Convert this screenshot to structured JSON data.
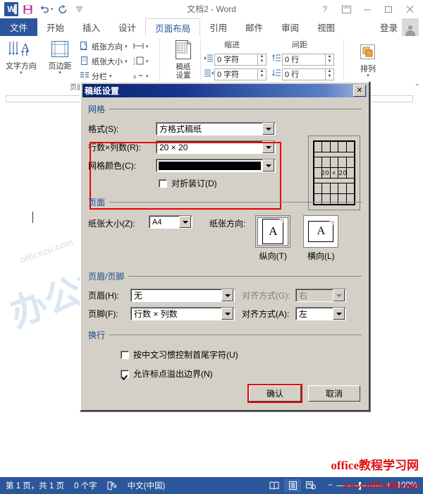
{
  "titlebar": {
    "doc_title": "文档2 - Word",
    "logo": "W",
    "save_icon": "save-icon",
    "undo_icon": "undo-icon",
    "redo_icon": "redo-icon",
    "customize_icon": "customize-qat-icon",
    "help": "?",
    "ribbon_display": "ribbon-display-options-icon",
    "minimize": "−",
    "maximize": "▢",
    "close": "✕"
  },
  "tabs": {
    "file": "文件",
    "items": [
      "开始",
      "插入",
      "设计",
      "页面布局",
      "引用",
      "邮件",
      "审阅",
      "视图"
    ],
    "active": "页面布局",
    "signin": "登录"
  },
  "ribbon": {
    "group_page_setup": "页面设置",
    "text_direction": "文字方向",
    "margins": "页边距",
    "paper_orientation": "纸张方向",
    "paper_size": "纸张大小",
    "columns": "分栏",
    "breaks_icon": "breaks-icon",
    "line_numbers_icon": "line-numbers-icon",
    "hyphenation_icon": "hyphenation-icon",
    "manuscript_setup": "稿纸\n设置",
    "manuscript_setup_l1": "稿纸",
    "manuscript_setup_l2": "设置",
    "indent_label": "缩进",
    "spacing_label": "间距",
    "indent_left": "0 字符",
    "indent_right": "0 字符",
    "spacing_before": "0 行",
    "spacing_after": "0 行",
    "arrange": "排列"
  },
  "dialog": {
    "title": "稿纸设置",
    "close": "✕",
    "grid_section": "网格",
    "format_label": "格式(S):",
    "format_value": "方格式稿纸",
    "rowscols_label": "行数×列数(R):",
    "rowscols_value": "20 × 20",
    "gridcolor_label": "网格颜色(C):",
    "gridcolor_value": "#000000",
    "fold_binding_label": "对折装订(D)",
    "fold_binding_checked": false,
    "preview_text": "20 × 20",
    "page_section": "页面",
    "papersize_label": "纸张大小(Z):",
    "papersize_value": "A4",
    "paperorient_label": "纸张方向:",
    "orient_portrait": "纵向(T)",
    "orient_landscape": "横向(L)",
    "orient_letter": "A",
    "headerfooter_section": "页眉/页脚",
    "header_label": "页眉(H):",
    "header_value": "无",
    "header_align_label": "对齐方式(G):",
    "header_align_value": "右",
    "footer_label": "页脚(F):",
    "footer_value": "行数 × 列数",
    "footer_align_label": "对齐方式(A):",
    "footer_align_value": "左",
    "wrap_section": "换行",
    "wrap_opt1": "按中文习惯控制首尾字符(U)",
    "wrap_opt1_checked": false,
    "wrap_opt2": "允许标点溢出边界(N)",
    "wrap_opt2_checked": true,
    "ok": "确认",
    "cancel": "取消",
    "highlight_color": "#e60000"
  },
  "statusbar": {
    "pages": "第 1 页，共 1 页",
    "words": "0 个字",
    "proofing_icon": "proofing-icon",
    "language": "中文(中国)",
    "view_read": "read-mode-icon",
    "view_print": "print-layout-icon",
    "view_web": "web-layout-icon",
    "zoom_out": "−",
    "zoom_in": "+",
    "zoom_pct": "100%"
  },
  "watermarks": {
    "red_line1": "office教程学习网",
    "red_line2": "www.office68.com",
    "blue_text": "办公族",
    "blue_small": "officezu.com"
  },
  "colors": {
    "word_blue": "#2B579A",
    "dialog_face": "#d4d0c8",
    "dialog_title_start": "#0a246a",
    "highlight_red": "#e60000",
    "section_label_blue": "#1a4a8a"
  }
}
